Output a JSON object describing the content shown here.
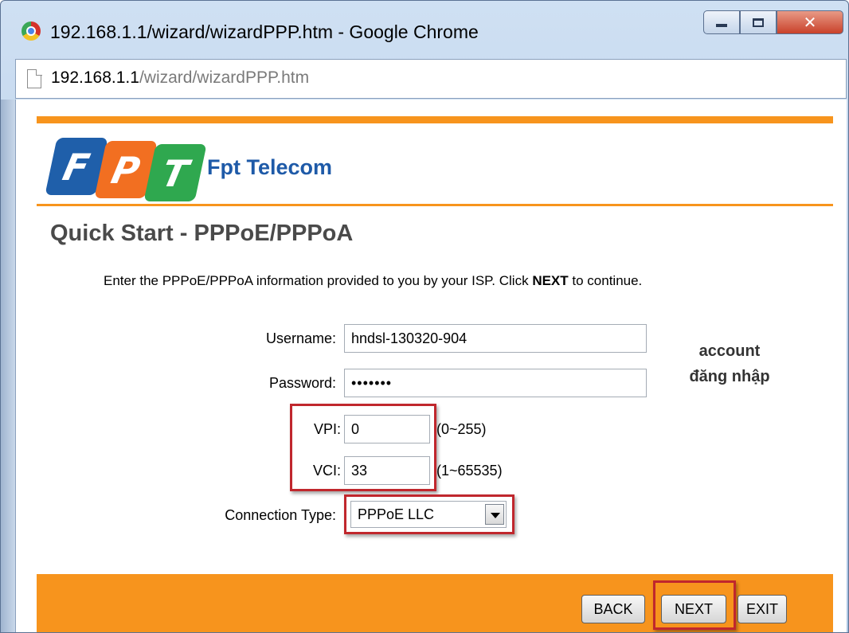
{
  "window": {
    "title": "192.168.1.1/wizard/wizardPPP.htm - Google Chrome",
    "controls": {
      "minimize": "minimize",
      "maximize": "maximize",
      "close": "close"
    }
  },
  "address_bar": {
    "url_host": "192.168.1.1",
    "url_path": "/wizard/wizardPPP.htm"
  },
  "branding": {
    "logo_letters": [
      "F",
      "P",
      "T"
    ],
    "brand_name": "Fpt Telecom",
    "colors": {
      "orange": "#f7941d",
      "blue": "#1f5faa",
      "logo_orange": "#f26f21",
      "green": "#2fa84f",
      "highlight_red": "#c0272d"
    }
  },
  "page": {
    "heading": "Quick Start - PPPoE/PPPoA",
    "instructions_before": "Enter the PPPoE/PPPoA information provided to you by your ISP. Click ",
    "instructions_bold": "NEXT",
    "instructions_after": " to continue."
  },
  "form": {
    "username_label": "Username:",
    "username_value": "hndsl-130320-904",
    "password_label": "Password:",
    "password_value": "•••••••",
    "vpi_label": "VPI:",
    "vpi_value": "0",
    "vpi_hint": "(0~255)",
    "vci_label": "VCI:",
    "vci_value": "33",
    "vci_hint": "(1~65535)",
    "connection_type_label": "Connection Type:",
    "connection_type_value": "PPPoE LLC"
  },
  "annotation": {
    "line1": "account",
    "line2": "đăng nhập"
  },
  "buttons": {
    "back": "BACK",
    "next": "NEXT",
    "exit": "EXIT"
  }
}
